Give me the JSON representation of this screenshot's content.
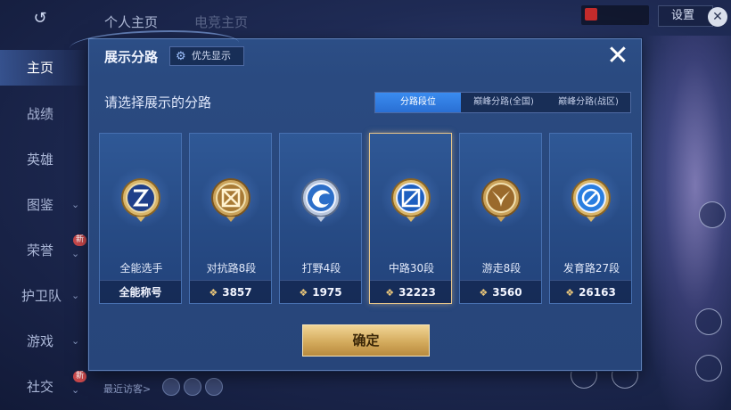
{
  "topbar": {
    "tabs": [
      "个人主页",
      "电竞主页"
    ],
    "settings_label": "设置"
  },
  "sidebar": {
    "items": [
      {
        "label": "主页",
        "active": true,
        "chevron": false,
        "new": false
      },
      {
        "label": "战绩",
        "active": false,
        "chevron": false,
        "new": false
      },
      {
        "label": "英雄",
        "active": false,
        "chevron": false,
        "new": false
      },
      {
        "label": "图鉴",
        "active": false,
        "chevron": true,
        "new": false
      },
      {
        "label": "荣誉",
        "active": false,
        "chevron": true,
        "new": true
      },
      {
        "label": "护卫队",
        "active": false,
        "chevron": true,
        "new": false
      },
      {
        "label": "游戏",
        "active": false,
        "chevron": true,
        "new": false
      },
      {
        "label": "社交",
        "active": false,
        "chevron": true,
        "new": true
      }
    ],
    "new_tag": "新",
    "recent_visitors": "最近访客>"
  },
  "modal": {
    "title": "展示分路",
    "priority_button": "优先显示",
    "prompt": "请选择展示的分路",
    "tabs": [
      "分路段位",
      "巅峰分路(全国)",
      "巅峰分路(战区)"
    ],
    "active_tab": 0,
    "cards": [
      {
        "name": "全能选手",
        "footer": "全能称号",
        "has_points": false,
        "selected": false,
        "emblem": "allround-emblem-icon"
      },
      {
        "name": "对抗路8段",
        "footer": "3857",
        "has_points": true,
        "selected": false,
        "emblem": "clash-lane-emblem-icon"
      },
      {
        "name": "打野4段",
        "footer": "1975",
        "has_points": true,
        "selected": false,
        "emblem": "jungle-emblem-icon"
      },
      {
        "name": "中路30段",
        "footer": "32223",
        "has_points": true,
        "selected": true,
        "emblem": "mid-lane-emblem-icon"
      },
      {
        "name": "游走8段",
        "footer": "3560",
        "has_points": true,
        "selected": false,
        "emblem": "roam-emblem-icon"
      },
      {
        "name": "发育路27段",
        "footer": "26163",
        "has_points": true,
        "selected": false,
        "emblem": "farm-lane-emblem-icon"
      }
    ],
    "confirm_button": "确定"
  },
  "colors": {
    "modal_bg": "#2a4a80",
    "active_tab": "#3a8cf0",
    "gold": "#e8c57a",
    "selected_border": "#e6c58a"
  }
}
